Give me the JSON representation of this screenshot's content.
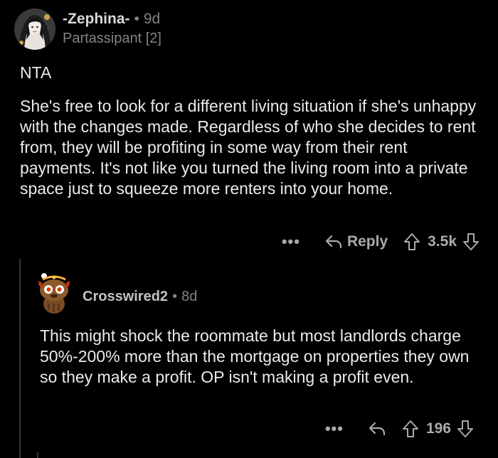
{
  "comments": [
    {
      "username": "-Zephina-",
      "separator": "•",
      "age": "9d",
      "flair": "Partassipant [2]",
      "avatar_icon": "anime-woman-avatar-icon",
      "body": [
        "NTA",
        "She's free to look for a different living situation if she's unhappy with the changes made. Regardless of who she decides to rent from, they will be profiting in some way from their rent payments. It's not like you turned the living room into a private space just to squeeze more renters into your home."
      ],
      "actions": {
        "more_label": "•••",
        "reply_label": "Reply",
        "score": "3.5k"
      }
    },
    {
      "username": "Crosswired2",
      "separator": "•",
      "age": "8d",
      "avatar_icon": "snoo-bear-avatar-icon",
      "body": [
        "This might shock the roommate but most landlords charge 50%-200% more than the mortgage on properties they own so they make a profit. OP isn't making a profit even."
      ],
      "actions": {
        "more_label": "•••",
        "score": "196"
      }
    }
  ],
  "colors": {
    "background": "#000000",
    "text_primary": "#e9ebec",
    "text_meta": "#818384",
    "action_icon": "#a8aaab",
    "thread_line": "#343536"
  }
}
